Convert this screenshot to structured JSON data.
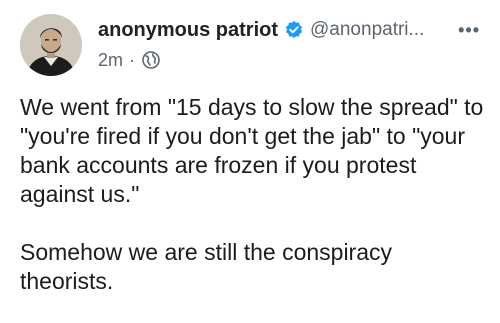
{
  "post": {
    "author": {
      "display_name": "anonymous patriot",
      "handle": "@anonpatri...",
      "verified": true,
      "avatar": "portrait-avatar"
    },
    "time": "2m",
    "separator": "·",
    "audience_icon": "globe-icon",
    "more_label": "•••",
    "paragraphs": [
      "We went from \"15 days to slow the spread\" to \"you're fired if you don't get the jab\" to \"your bank accounts are frozen if you protest against us.\"",
      "Somehow we are still the conspiracy theorists."
    ]
  },
  "colors": {
    "verified_blue": "#1d9bf0",
    "secondary_text": "#5b6670",
    "primary_text": "#1c1c1c"
  }
}
